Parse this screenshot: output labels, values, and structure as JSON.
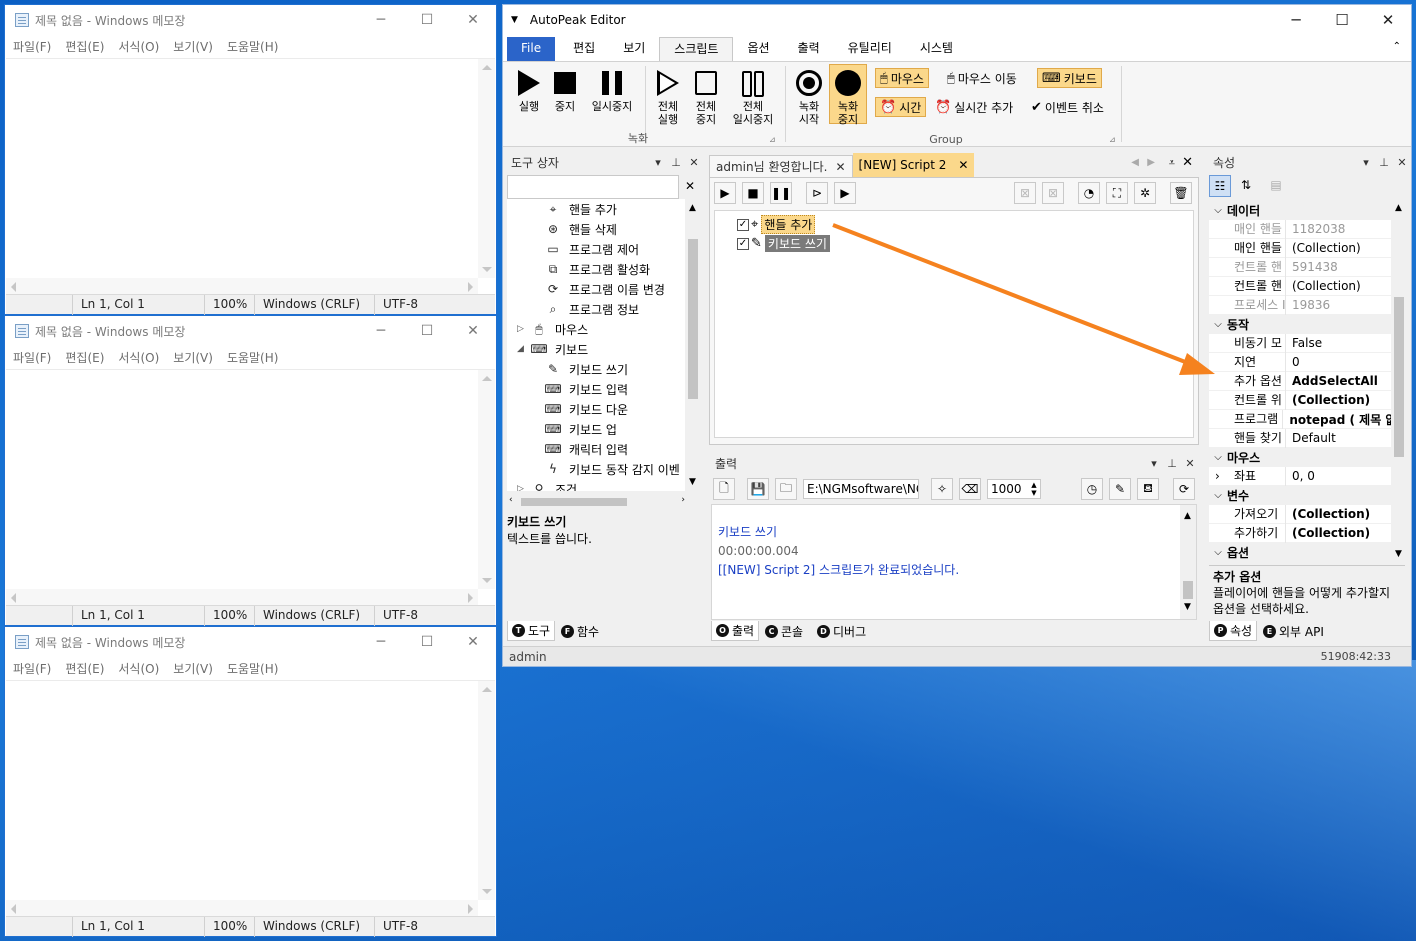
{
  "notepad": {
    "title": "제목 없음 - Windows 메모장",
    "menu": [
      "파일(F)",
      "편집(E)",
      "서식(O)",
      "보기(V)",
      "도움말(H)"
    ],
    "status": {
      "pos": "Ln 1, Col 1",
      "zoom": "100%",
      "eol": "Windows (CRLF)",
      "enc": "UTF-8"
    }
  },
  "app": {
    "title": "AutoPeak Editor",
    "tabs": [
      "File",
      "편집",
      "보기",
      "스크립트",
      "옵션",
      "출력",
      "유틸리티",
      "시스템"
    ],
    "ribbon": {
      "run": "실행",
      "stop": "중지",
      "pause": "일시중지",
      "run_all": "전체\n실행",
      "stop_all": "전체\n중지",
      "pause_all": "전체\n일시중지",
      "rec_start": "녹화\n시작",
      "rec_stop": "녹화\n중지",
      "group_rec": "녹화",
      "group_group": "Group",
      "mouse": "마우스",
      "mouse_move": "마우스 이동",
      "keyboard": "키보드",
      "time": "시간",
      "realtime_add": "실시간 추가",
      "event_cancel": "이벤트 취소"
    },
    "toolbox": {
      "title": "도구 상자",
      "items": [
        {
          "label": "핸들 추가",
          "icon": "⌖",
          "indent": 2
        },
        {
          "label": "핸들 삭제",
          "icon": "⊛",
          "indent": 2
        },
        {
          "label": "프로그램 제어",
          "icon": "▭",
          "indent": 2
        },
        {
          "label": "프로그램 활성화",
          "icon": "⧉",
          "indent": 2
        },
        {
          "label": "프로그램 이름 변경",
          "icon": "⟳",
          "indent": 2
        },
        {
          "label": "프로그램 정보",
          "icon": "⌕",
          "indent": 2
        },
        {
          "label": "마우스",
          "icon": "🖱",
          "indent": 1,
          "exp": "▷"
        },
        {
          "label": "키보드",
          "icon": "⌨",
          "indent": 1,
          "exp": "◢"
        },
        {
          "label": "키보드 쓰기",
          "icon": "✎",
          "indent": 2
        },
        {
          "label": "키보드 입력",
          "icon": "⌨",
          "indent": 2
        },
        {
          "label": "키보드 다운",
          "icon": "⌨",
          "indent": 2
        },
        {
          "label": "키보드 업",
          "icon": "⌨",
          "indent": 2
        },
        {
          "label": "캐릭터 입력",
          "icon": "⌨",
          "indent": 2
        },
        {
          "label": "키보드 동작 감지 이벤",
          "icon": "ϟ",
          "indent": 2
        },
        {
          "label": "조건",
          "icon": "⚲",
          "indent": 1,
          "exp": "▷"
        }
      ],
      "desc_title": "키보드 쓰기",
      "desc": "텍스트를 씁니다.",
      "tab_tools": "도구",
      "tab_funcs": "함수"
    },
    "doc_tabs": [
      "admin님 환영합니다.",
      "[NEW] Script 2"
    ],
    "script": {
      "items": [
        "핸들 추가",
        "키보드 쓰기"
      ]
    },
    "output": {
      "title": "출력",
      "path": "E:\\NGMsoftware\\NG",
      "interval": "1000",
      "lines": [
        "키보드 쓰기",
        "00:00:00.004",
        "[[NEW] Script 2] 스크립트가 완료되었습니다."
      ],
      "tab_out": "출력",
      "tab_console": "콘솔",
      "tab_debug": "디버그"
    },
    "props": {
      "title": "속성",
      "rows": [
        {
          "cat": "데이터"
        },
        {
          "k": "매인 핸들",
          "v": "1182038",
          "gray": true
        },
        {
          "k": "매인 핸들",
          "v": "(Collection)"
        },
        {
          "k": "컨트롤 핸",
          "v": "591438",
          "gray": true
        },
        {
          "k": "컨트롤 핸",
          "v": "(Collection)"
        },
        {
          "k": "프로세스 I",
          "v": "19836",
          "gray": true
        },
        {
          "cat": "동작"
        },
        {
          "k": "비동기 모",
          "v": "False"
        },
        {
          "k": "지연",
          "v": "0"
        },
        {
          "k": "추가 옵션",
          "v": "AddSelectAll",
          "bold": true
        },
        {
          "k": "컨트롤 위",
          "v": "(Collection)",
          "bold": true
        },
        {
          "k": "프로그램 ·",
          "v": "notepad ( 제목 없",
          "bold": true
        },
        {
          "k": "핸들 찾기",
          "v": "Default"
        },
        {
          "cat": "마우스"
        },
        {
          "k": "좌표",
          "v": "0, 0",
          "exp": true
        },
        {
          "cat": "변수"
        },
        {
          "k": "가져오기",
          "v": "(Collection)",
          "bold": true
        },
        {
          "k": "추가하기",
          "v": "(Collection)",
          "bold": true
        },
        {
          "cat": "옵션"
        }
      ],
      "desc_title": "추가 옵션",
      "desc": "플레이어에 핸들을 어떻게 추가할지 옵션을 선택하세요.",
      "tab_props": "속성",
      "tab_api": "외부 API"
    },
    "status": {
      "user": "admin",
      "time": "51908:42:33"
    }
  },
  "colors": {
    "accent": "#2b64c9",
    "highlight": "#fbd88b",
    "arrow": "#f5821f",
    "output_blue": "#1a3fc4"
  }
}
